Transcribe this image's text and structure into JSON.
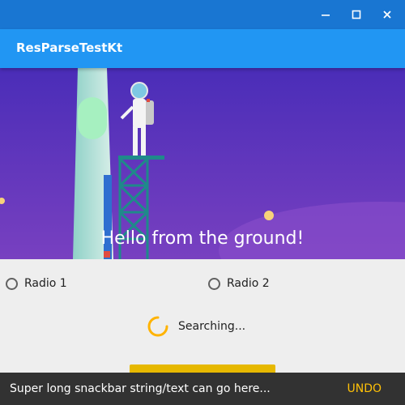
{
  "window": {
    "controls": [
      "minimize",
      "maximize",
      "close"
    ]
  },
  "appbar": {
    "title": "ResParseTestKt"
  },
  "hero": {
    "text": "Hello from the ground!"
  },
  "radios": [
    {
      "label": "Radio 1",
      "checked": false
    },
    {
      "label": "Radio 2",
      "checked": false
    }
  ],
  "status": {
    "text": "Searching..."
  },
  "snackbar": {
    "message": "Super long snackbar string/text can go here...",
    "action": "UNDO"
  },
  "colors": {
    "titlebar": "#1976d2",
    "appbar": "#2196f3",
    "accent": "#ffc107",
    "hero_top": "#4a2db8",
    "hero_bottom": "#7840c0",
    "snackbar": "#323232"
  }
}
